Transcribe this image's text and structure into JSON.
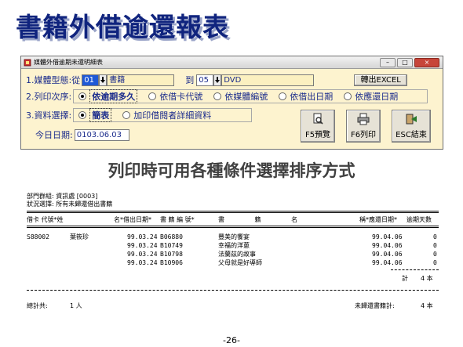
{
  "page_title": "書籍外借逾還報表",
  "window": {
    "title": "媒體外借逾期未還明細表",
    "controls": [
      "–",
      "□",
      "×"
    ],
    "row1": {
      "label": "1.媒體型態:從",
      "from_code": "01",
      "from_name": "書籍",
      "to_label": "到",
      "to_code": "05",
      "to_name": "DVD",
      "export_button": "轉出EXCEL"
    },
    "row2": {
      "label": "2.列印次序:",
      "options": [
        "依逾期多久",
        "依借卡代號",
        "依媒體編號",
        "依借出日期",
        "依應還日期"
      ],
      "selected": 0
    },
    "row3": {
      "label": "3.資料選擇:",
      "options": [
        "簡表",
        "加印借閱者詳細資料"
      ],
      "selected": 0
    },
    "today": {
      "label": "今日日期:",
      "value": "0103.06.03"
    },
    "buttons": [
      {
        "label": "F5預覽",
        "icon": "preview-icon"
      },
      {
        "label": "F6列印",
        "icon": "printer-icon"
      },
      {
        "label": "ESC結束",
        "icon": "exit-icon"
      }
    ]
  },
  "subtitle": "列印時可用各種條件選擇排序方式",
  "report": {
    "dept": "部門群組: 資訊處 [0003]",
    "status": "狀況選擇: 所有未歸還借出書籍",
    "headers": {
      "card": "借卡 代號*姓",
      "name_end": "名*",
      "loan_date": "借出日期*",
      "book_code": "書 籍 編 號*",
      "book_title": "書 籍 名",
      "title_end": "稱*",
      "due_date": "應還日期*",
      "overdue": "逾期天數"
    },
    "borrower": {
      "card": "S88002",
      "name": "葉筱珍"
    },
    "rows": [
      {
        "loan_date": "99.03.24",
        "book_code": "B06880",
        "title": "豐美的饗宴",
        "due_date": "99.04.06",
        "overdue": "0"
      },
      {
        "loan_date": "99.03.24",
        "book_code": "B10749",
        "title": "幸福的洋蔥",
        "due_date": "99.04.06",
        "overdue": "0"
      },
      {
        "loan_date": "99.03.24",
        "book_code": "B10798",
        "title": "法蘭茲的故事",
        "due_date": "99.04.06",
        "overdue": "0"
      },
      {
        "loan_date": "99.03.24",
        "book_code": "B10906",
        "title": "父母就是好導師",
        "due_date": "99.04.06",
        "overdue": "0"
      }
    ],
    "subtotal": {
      "label": "計",
      "value": "4 本"
    },
    "total": {
      "people_label": "總計共:",
      "people_value": "1 人",
      "books_label": "未歸還書籍計:",
      "books_value": "4 本"
    }
  },
  "page_number": "-26-"
}
